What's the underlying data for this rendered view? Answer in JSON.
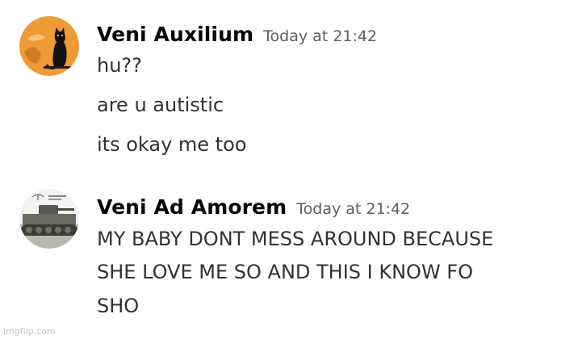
{
  "messages": [
    {
      "username": "Veni Auxilium",
      "timestamp": "Today at 21:42",
      "avatar_icon": "black-cat-moon-icon",
      "lines": [
        "hu??",
        "are u autistic",
        "its okay me too"
      ]
    },
    {
      "username": "Veni Ad Amorem",
      "timestamp": "Today at 21:42",
      "avatar_icon": "tank-icon",
      "lines": [
        "MY BABY DONT MESS AROUND BECAUSE",
        "SHE LOVE ME SO AND THIS I KNOW FO",
        "SHO"
      ]
    }
  ],
  "watermark": "imgflip.com",
  "colors": {
    "background": "#ffffff",
    "username": "#060607",
    "timestamp": "#5c5e66",
    "message_text": "#2e3338",
    "avatar1_bg": "#f2a23c"
  }
}
